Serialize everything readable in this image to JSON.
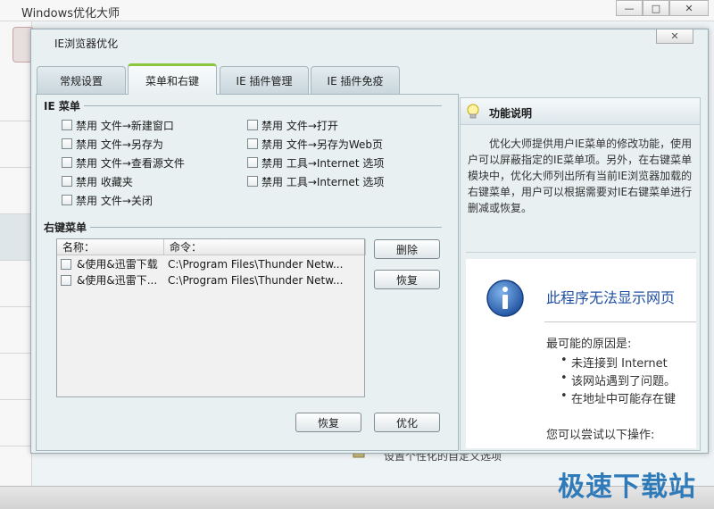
{
  "main_window": {
    "title": "Windows优化大师",
    "minimize": "—",
    "maximize": "□",
    "close": "✕",
    "bottom_text": "设置个性化的自定义选项"
  },
  "watermark": "极速下载站",
  "dialog": {
    "title": "IE浏览器优化",
    "close": "✕",
    "tabs": [
      {
        "label": "常规设置"
      },
      {
        "label": "菜单和右键",
        "active": true
      },
      {
        "label": "IE 插件管理"
      },
      {
        "label": "IE 插件免疫"
      }
    ]
  },
  "ie_menu": {
    "label": "IE 菜单",
    "options": [
      {
        "label": "禁用 文件→新建窗口",
        "checked": false
      },
      {
        "label": "禁用 文件→另存为",
        "checked": false
      },
      {
        "label": "禁用 文件→查看源文件",
        "checked": false
      },
      {
        "label": "禁用 收藏夹",
        "checked": false
      },
      {
        "label": "禁用 文件→关闭",
        "checked": false
      },
      {
        "label": "禁用 文件→打开",
        "checked": false
      },
      {
        "label": "禁用 文件→另存为Web页",
        "checked": false
      },
      {
        "label": "禁用 工具→Internet 选项",
        "checked": false
      },
      {
        "label": "禁用 工具→Internet 选项",
        "checked": false
      }
    ]
  },
  "context_menu": {
    "label": "右键菜单",
    "columns": [
      "名称：",
      "命令："
    ],
    "rows": [
      {
        "name": "&使用&迅雷下载",
        "command": "C:\\Program Files\\Thunder Netw...",
        "checked": false
      },
      {
        "name": "&使用&迅雷下...",
        "command": "C:\\Program Files\\Thunder Netw...",
        "checked": false
      }
    ],
    "delete_button": "删除",
    "restore_button": "恢复"
  },
  "footer": {
    "restore_button": "恢复",
    "optimize_button": "优化"
  },
  "help": {
    "title": "功能说明",
    "description": "优化大师提供用户IE菜单的修改功能，使用户可以屏蔽指定的IE菜单项。另外，在右键菜单模块中，优化大师列出所有当前IE浏览器加载的右键菜单，用户可以根据需要对IE右键菜单进行删减或恢复。",
    "web": {
      "title": "此程序无法显示网页",
      "subtitle": "最可能的原因是:",
      "bullets": [
        "未连接到 Internet",
        "该网站遇到了问题。",
        "在地址中可能存在键"
      ],
      "try": "您可以尝试以下操作:"
    }
  }
}
